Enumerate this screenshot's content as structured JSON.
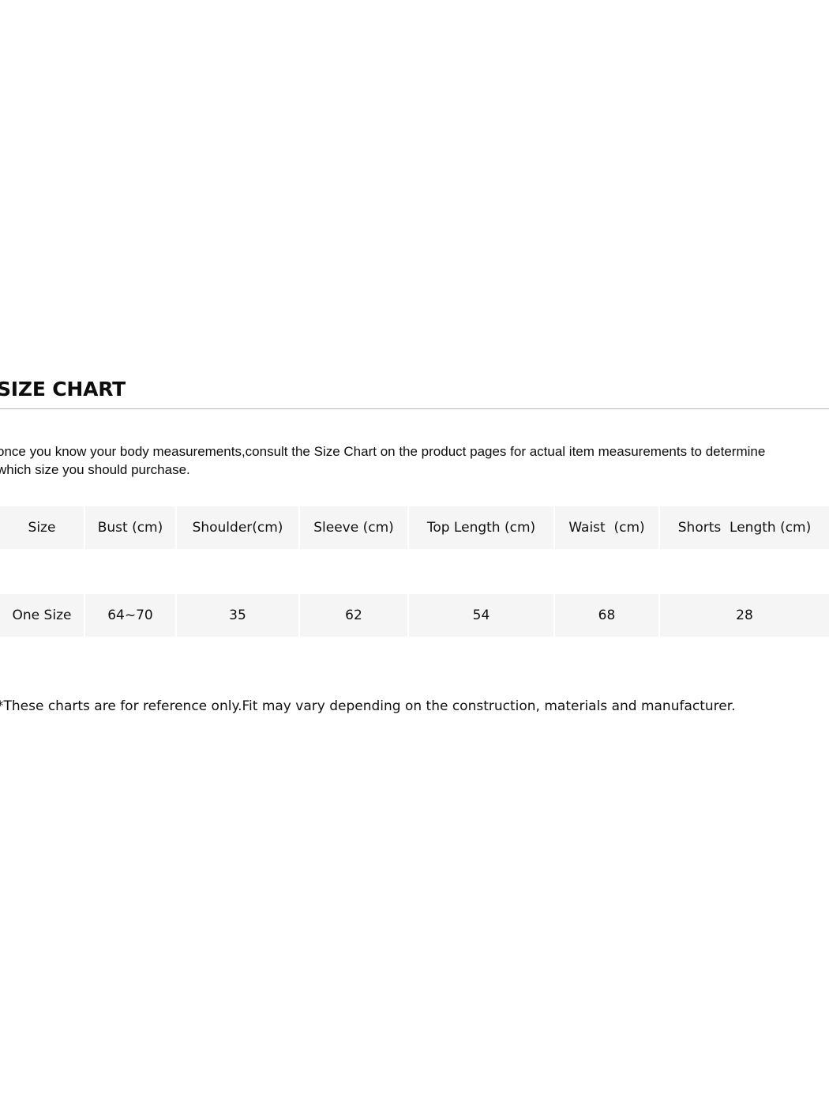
{
  "document": {
    "title": "SIZE CHART",
    "intro": "once you know your body measurements,consult the Size Chart on the product pages for actual item measurements to determine\nwhich size you should purchase.",
    "footnote": "*These charts are for reference only.Fit may vary depending on the construction, materials and manufacturer."
  },
  "table": {
    "headers": [
      "Size",
      "Bust (cm)",
      "Shoulder(cm)",
      "Sleeve (cm)",
      "Top Length (cm)",
      "Waist  (cm)",
      "Shorts  Length (cm)"
    ],
    "rows": [
      {
        "size": "One Size",
        "bust": "64~70",
        "shoulder": "35",
        "sleeve": "62",
        "top_length": "54",
        "waist": "68",
        "shorts_length": "28"
      }
    ]
  },
  "colors": {
    "page_background": "#ffffff",
    "cell_background": "#f5f5f5",
    "cell_divider": "#ffffff",
    "rule": "#b9b9b9",
    "text": "#111111"
  }
}
